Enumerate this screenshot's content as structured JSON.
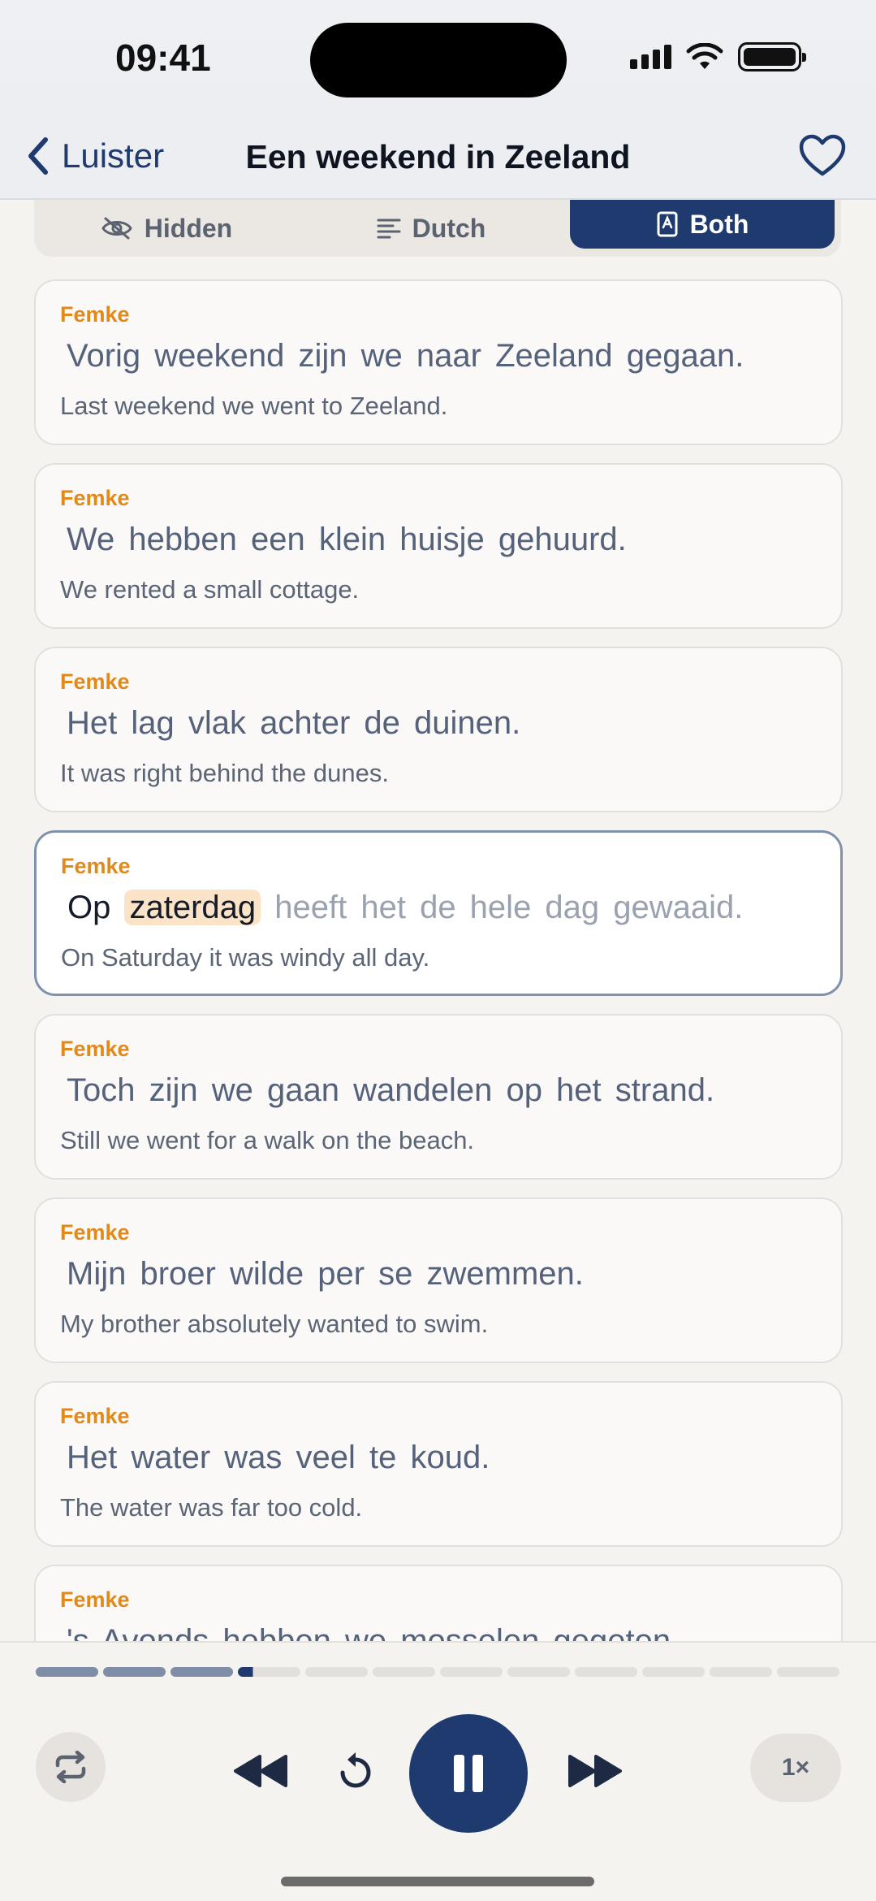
{
  "status": {
    "time": "09:41"
  },
  "nav": {
    "back_label": "Luister",
    "title": "Een weekend in Zeeland"
  },
  "modes": [
    {
      "label": "Hidden",
      "icon": "eye-slash-icon",
      "active": false
    },
    {
      "label": "Dutch",
      "icon": "text-lines-icon",
      "active": false
    },
    {
      "label": "Both",
      "icon": "book-icon",
      "active": true
    }
  ],
  "lines": [
    {
      "speaker": "Femke",
      "dutch": "Vorig weekend zijn we naar Zeeland gegaan.",
      "english": "Last weekend we went to Zeeland."
    },
    {
      "speaker": "Femke",
      "dutch": "We hebben een klein huisje gehuurd.",
      "english": "We rented a small cottage."
    },
    {
      "speaker": "Femke",
      "dutch": "Het lag vlak achter de duinen.",
      "english": "It was right behind the dunes."
    },
    {
      "speaker": "Femke",
      "dutch_done": "Op",
      "dutch_current": "zaterdag",
      "dutch_todo": "heeft het de hele dag gewaaid.",
      "english": "On Saturday it was windy all day.",
      "active": true
    },
    {
      "speaker": "Femke",
      "dutch": "Toch zijn we gaan wandelen op het strand.",
      "english": "Still we went for a walk on the beach."
    },
    {
      "speaker": "Femke",
      "dutch": "Mijn broer wilde per se zwemmen.",
      "english": "My brother absolutely wanted to swim."
    },
    {
      "speaker": "Femke",
      "dutch": "Het water was veel te koud.",
      "english": "The water was far too cold."
    },
    {
      "speaker": "Femke",
      "dutch": "'s Avonds hebben we mosselen gegeten."
    }
  ],
  "player": {
    "segments_total": 12,
    "segments_done": 3,
    "current_segment_fraction": 0.24,
    "speed_label": "1×",
    "state": "playing"
  },
  "colors": {
    "accent": "#1e3a6e",
    "speaker": "#e08a1e",
    "highlight": "#fbe3c8"
  }
}
